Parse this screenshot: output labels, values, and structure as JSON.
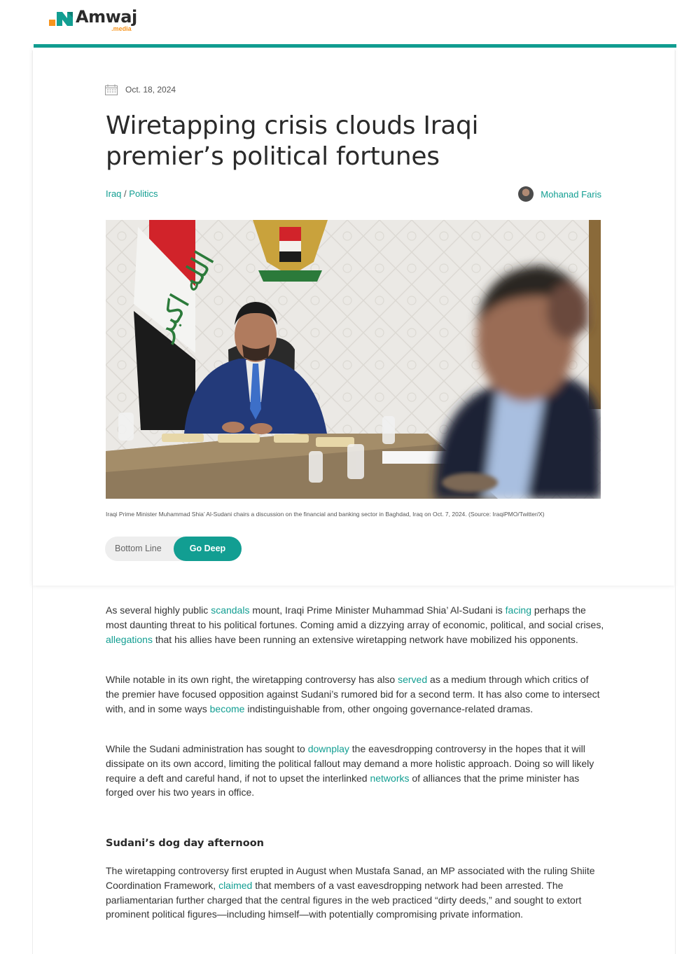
{
  "brand": {
    "name": "Amwaj",
    "sub": ".media",
    "accent": "#129e92",
    "orange": "#f7941d"
  },
  "article": {
    "date": "Oct. 18, 2024",
    "title": "Wiretapping crisis clouds Iraqi premier’s political fortunes",
    "breadcrumb": {
      "country": "Iraq",
      "separator": "/",
      "section": "Politics"
    },
    "author": "Mohanad Faris",
    "caption": "Iraqi Prime Minister Muhammad Shia’ Al-Sudani chairs a discussion on the financial and banking sector in Baghdad, Iraq on Oct. 7, 2024. (Source: IraqiPMO/Twitter/X)",
    "toggle": {
      "bottom_line": "Bottom Line",
      "go_deep": "Go Deep",
      "selected": "Go Deep"
    }
  },
  "paragraphs": {
    "p1": {
      "a": "As several highly public ",
      "l1": "scandals",
      "b": " mount, Iraqi Prime Minister Muhammad Shia’ Al-Sudani is ",
      "l2": "facing",
      "c": " perhaps the most daunting threat to his political fortunes. Coming amid a dizzying array of economic, political, and social crises, ",
      "l3": "allegations",
      "d": " that his allies have been running an extensive wiretapping network have mobilized his opponents."
    },
    "p2": {
      "a": "While notable in its own right, the wiretapping controversy has also ",
      "l1": "served",
      "b": " as a medium through which critics of the premier have focused opposition against Sudani’s rumored bid for a second term. It has also come to intersect with, and in some ways ",
      "l2": "become",
      "c": " indistinguishable from, other ongoing governance-related dramas."
    },
    "p3": {
      "a": "While the Sudani administration has sought to ",
      "l1": "downplay",
      "b": " the eavesdropping controversy in the hopes that it will dissipate on its own accord, limiting the political fallout may demand a more holistic approach. Doing so will likely require a deft and careful hand, if not to upset the interlinked ",
      "l2": "networks",
      "c": " of alliances that the prime minister has forged over his two years in office."
    },
    "subhead": "Sudani’s dog day afternoon",
    "p5": {
      "a": "The wiretapping controversy first erupted in August when Mustafa Sanad, an MP associated with the ruling Shiite Coordination Framework, ",
      "l1": "claimed",
      "b": " that members of a vast eavesdropping network had been arrested. The parliamentarian further charged that the central figures in the web practiced “dirty deeds,” and sought to extort prominent political figures—including himself—with potentially compromising private information."
    }
  }
}
